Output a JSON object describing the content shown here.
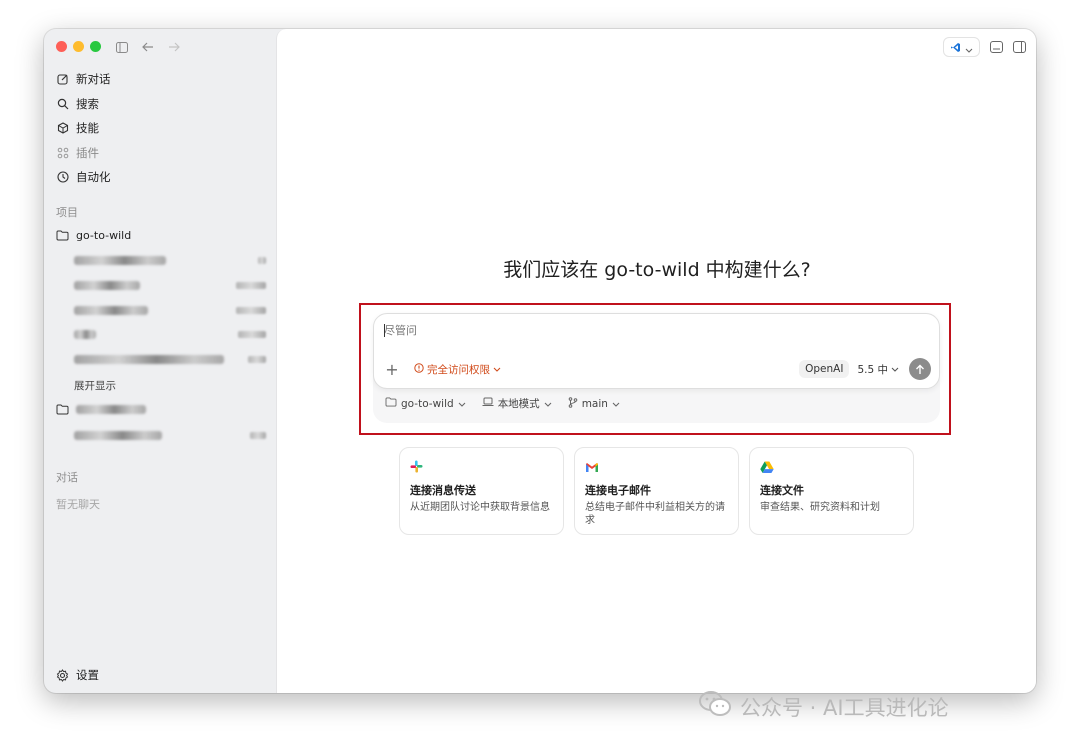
{
  "sidebar": {
    "nav": [
      {
        "label": "新对话",
        "icon": "edit-icon"
      },
      {
        "label": "搜索",
        "icon": "search-icon"
      },
      {
        "label": "技能",
        "icon": "cube-icon"
      },
      {
        "label": "插件",
        "icon": "grid-icon"
      },
      {
        "label": "自动化",
        "icon": "clock-icon"
      }
    ],
    "projects_label": "项目",
    "project_1": {
      "name": "go-to-wild"
    },
    "expand_label": "展开显示",
    "conversations_label": "对话",
    "no_chats": "暂无聊天",
    "settings_label": "设置"
  },
  "main": {
    "heading": "我们应该在 go-to-wild 中构建什么?",
    "composer": {
      "placeholder": "尽管问",
      "access_label": "完全访问权限",
      "model_label": "OpenAI",
      "version_label": "5.5 中",
      "project_label": "go-to-wild",
      "mode_label": "本地模式",
      "branch_label": "main"
    },
    "cards": [
      {
        "title": "连接消息传送",
        "desc": "从近期团队讨论中获取背景信息",
        "icon": "slack-icon"
      },
      {
        "title": "连接电子邮件",
        "desc": "总结电子邮件中利益相关方的请求",
        "icon": "gmail-icon"
      },
      {
        "title": "连接文件",
        "desc": "审查结果、研究资料和计划",
        "icon": "google-drive-icon"
      }
    ]
  },
  "watermark": "公众号 · AI工具进化论",
  "colors": {
    "accent_red": "#c0111c",
    "access_orange": "#d14b1b"
  }
}
